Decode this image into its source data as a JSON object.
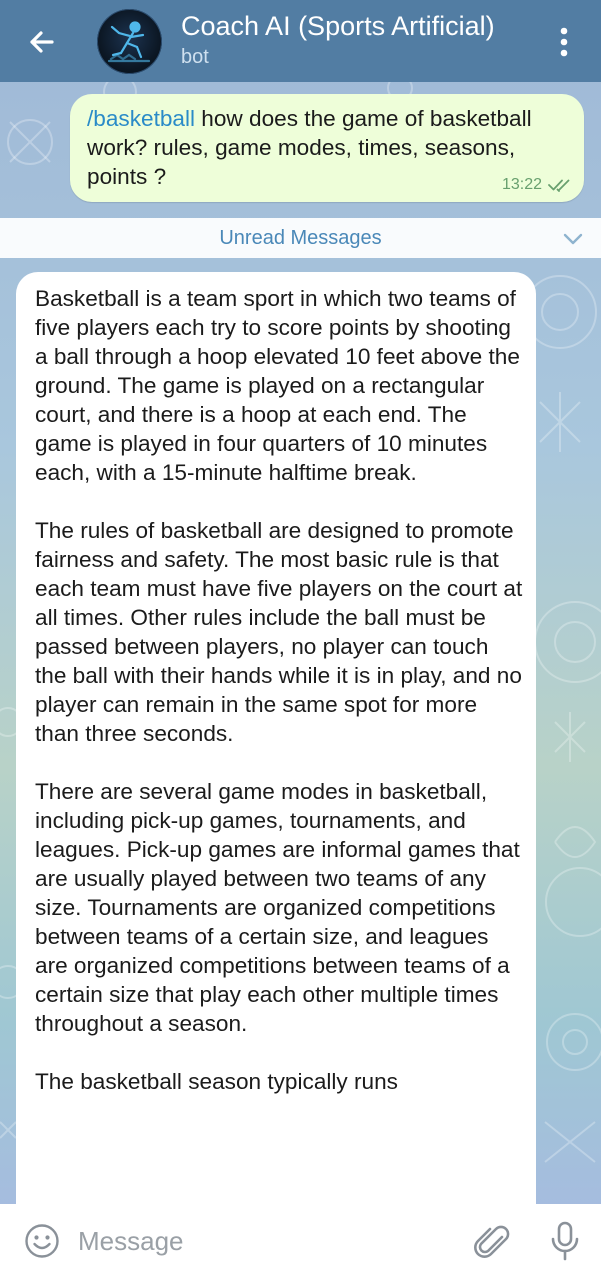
{
  "header": {
    "title": "Coach AI (Sports Artificial)",
    "subtitle": "bot",
    "avatar_icon": "basketball-player-avatar",
    "back_icon": "arrow-left-icon",
    "menu_icon": "more-vertical-icon"
  },
  "outgoing_message": {
    "command": "/basketball",
    "text": " how does the game of basketball work? rules, game modes, times, seasons, points ?",
    "time": "13:22",
    "status_icon": "double-check-icon"
  },
  "unread_bar": {
    "label": "Unread Messages"
  },
  "incoming_message": {
    "paragraphs": [
      "Basketball is a team sport in which two teams of five players each try to score points by shooting a ball through a hoop elevated 10 feet above the ground. The game is played on a rectangular court, and there is a hoop at each end. The game is played in four quarters of 10 minutes each, with a 15-minute halftime break.",
      "The rules of basketball are designed to promote fairness and safety. The most basic rule is that each team must have five players on the court at all times. Other rules include the ball must be passed between players, no player can touch the ball with their hands while it is in play, and no player can remain in the same spot for more than three seconds.",
      "There are several game modes in basketball, including pick-up games, tournaments, and leagues. Pick-up games are informal games that are usually played between two teams of any size. Tournaments are organized competitions between teams of a certain size, and leagues are organized competitions between teams of a certain size that play each other multiple times throughout a season.",
      "The basketball season typically runs"
    ]
  },
  "input_bar": {
    "placeholder": "Message",
    "emoji_icon": "emoji-icon",
    "attach_icon": "paperclip-icon",
    "mic_icon": "microphone-icon"
  },
  "colors": {
    "header_bg": "#527da3",
    "outgoing_bubble": "#eefed9",
    "command_link": "#2a8bc8",
    "unread_text": "#4a88b8",
    "check_marks": "#68a06e"
  }
}
